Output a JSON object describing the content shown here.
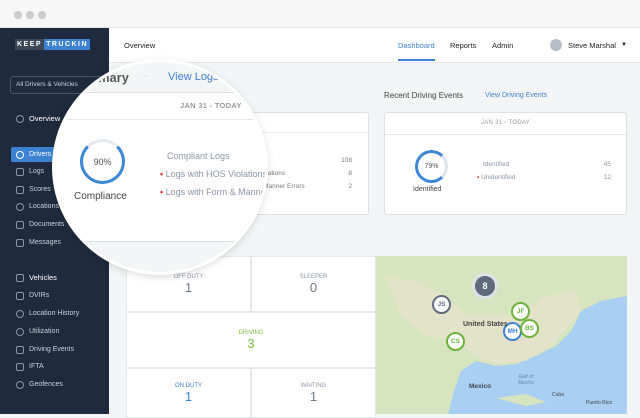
{
  "window": {
    "controls": [
      "close",
      "minimize",
      "maximize"
    ]
  },
  "logo": {
    "part1": "KEEP",
    "part2": "TRUCKIN"
  },
  "sidebar": {
    "selector": "All Drivers & Vehicles",
    "overview": "Overview",
    "items": [
      {
        "label": "Drivers",
        "icon": "user-icon",
        "active": true
      },
      {
        "label": "Logs",
        "icon": "log-icon"
      },
      {
        "label": "Scores",
        "icon": "trophy-icon"
      },
      {
        "label": "Locations",
        "icon": "pin-icon"
      },
      {
        "label": "Documents",
        "icon": "document-icon"
      },
      {
        "label": "Messages",
        "icon": "message-icon"
      }
    ],
    "vehicles_header": "Vehicles",
    "vehicle_items": [
      {
        "label": "DVIRs",
        "icon": "wrench-icon"
      },
      {
        "label": "Location History",
        "icon": "pin-icon"
      },
      {
        "label": "Utilization",
        "icon": "timer-icon"
      },
      {
        "label": "Driving Events",
        "icon": "calendar-icon"
      },
      {
        "label": "IFTA",
        "icon": "fuel-icon"
      },
      {
        "label": "Geofences",
        "icon": "geofence-icon"
      }
    ]
  },
  "header": {
    "breadcrumb": "Overview",
    "tabs": [
      "Dashboard",
      "Reports",
      "Admin"
    ],
    "active_tab": "Dashboard",
    "user": "Steve Marshal"
  },
  "logs_summary": {
    "title": "Logs Summary",
    "title_visible": "mmary",
    "link": "View Logs",
    "range": "JAN 31 - TODAY",
    "compliance_pct": 90,
    "compliance_label": "90%",
    "compliance_caption": "Compliance",
    "rows": [
      {
        "label": "Compliant Logs",
        "value": "108",
        "dot": false
      },
      {
        "label": "Logs with HOS Violations",
        "value": "8",
        "dot": true
      },
      {
        "label": "Logs with Form & Manner Errors",
        "value": "2",
        "dot": true
      }
    ]
  },
  "driving_events": {
    "title": "Recent Driving Events",
    "link": "View Driving Events",
    "range": "JAN 31 - TODAY",
    "pct": 79,
    "pct_label": "79%",
    "caption": "Identified",
    "rows": [
      {
        "label": "Identified",
        "value": "45",
        "dot": false
      },
      {
        "label": "Unidentified",
        "value": "12",
        "dot": true
      }
    ]
  },
  "statuses": [
    {
      "label": "OFF DUTY",
      "value": "1"
    },
    {
      "label": "SLEEPER",
      "value": "0"
    },
    {
      "label": "DRIVING",
      "value": "3"
    },
    {
      "label": "ON DUTY",
      "value": "1"
    },
    {
      "label": "WAITING",
      "value": "1"
    }
  ],
  "map": {
    "cluster": "8",
    "country": "United States",
    "mexico": "Mexico",
    "gulf": "Gulf of Mexico",
    "cuba": "Cuba",
    "pr": "Puerto Rico",
    "pins": [
      {
        "label": "JS",
        "color": "#5f6b7c"
      },
      {
        "label": "JF",
        "color": "#6ab43c"
      },
      {
        "label": "MH",
        "color": "#3d82d0"
      },
      {
        "label": "BS",
        "color": "#6ab43c"
      },
      {
        "label": "CS",
        "color": "#6ab43c"
      }
    ]
  },
  "colors": {
    "accent": "#3d82d0",
    "sidebar": "#1e2b3f",
    "driving": "#7cbf3e",
    "alert": "#e53935"
  }
}
